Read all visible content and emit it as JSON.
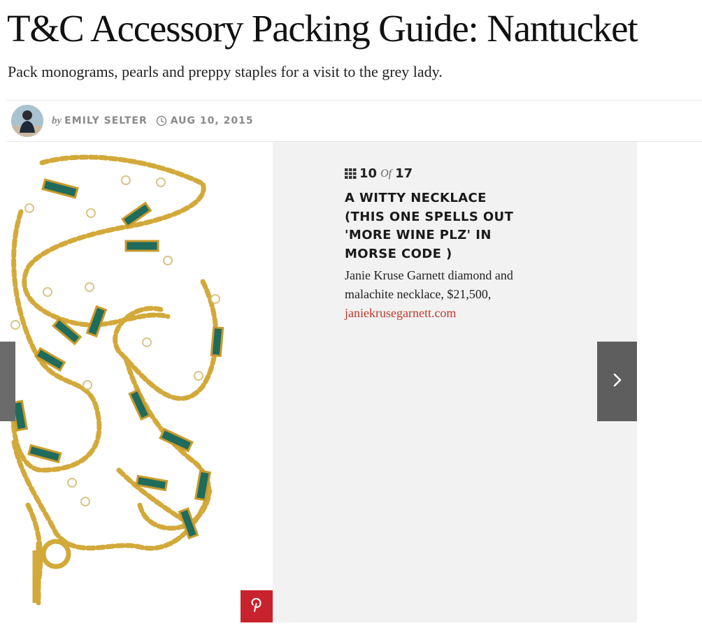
{
  "article": {
    "title": "T&C Accessory Packing Guide: Nantucket",
    "subtitle": "Pack monograms, pearls and preppy staples for a visit to the grey lady."
  },
  "byline": {
    "by": "by",
    "author": "EMILY SELTER",
    "date": "AUG 10, 2015"
  },
  "gallery": {
    "current": "10",
    "of": "Of",
    "total": "17",
    "slide_title": "A WITTY NECKLACE (THIS ONE SPELLS OUT 'MORE WINE PLZ' IN MORSE CODE )",
    "caption_text": "Janie Kruse Garnett diamond and malachite necklace, $21,500, ",
    "caption_link": "janiekrusegarnett.com"
  },
  "icons": {
    "clock": "clock-icon",
    "grid": "grid-icon",
    "next": "chevron-right-icon",
    "pin": "pinterest-icon"
  },
  "colors": {
    "link": "#c0392b",
    "pinterest": "#c8232c",
    "panel": "#f2f2f2",
    "nav": "#5e5e5e",
    "gold": "#d2a93a",
    "malachite": "#1f6b5c"
  }
}
